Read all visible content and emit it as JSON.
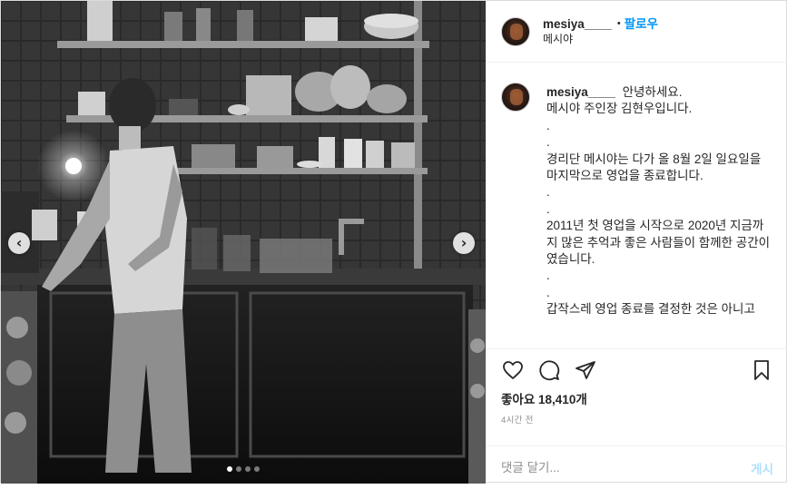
{
  "header": {
    "username": "mesiya____",
    "separator": "•",
    "follow_label": "팔로우",
    "location": "메시야"
  },
  "caption": {
    "username": "mesiya____",
    "lines": [
      "안녕하세요.",
      "메시야 주인장 김현우입니다.",
      ".",
      ".",
      "경리단 메시야는 다가 올 8월 2일 일요일을",
      "마지막으로 영업을 종료합니다.",
      ".",
      ".",
      "2011년 첫 영업을 시작으로 2020년 지금까지 많은 추억과 좋은 사람들이 함께한 공간이였습니다.",
      ".",
      ".",
      "갑작스레 영업 종료를 결정한 것은 아니고"
    ]
  },
  "icons": {
    "like": "heart-icon",
    "comment": "comment-icon",
    "share": "paper-plane-icon",
    "save": "bookmark-icon",
    "prev": "chevron-left-icon",
    "next": "chevron-right-icon"
  },
  "likes": {
    "label": "좋아요",
    "count": "18,410개"
  },
  "time": "4시간 전",
  "comment_box": {
    "placeholder": "댓글 달기...",
    "post_label": "게시"
  },
  "carousel": {
    "total": 4,
    "active_index": 0
  }
}
